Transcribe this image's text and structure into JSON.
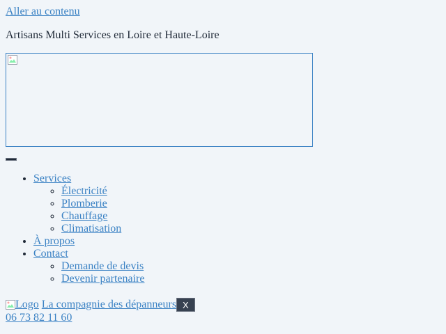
{
  "skip_link": "Aller au contenu",
  "tagline": "Artisans Multi Services en Loire et Haute-Loire",
  "banner": {
    "alt": ""
  },
  "menu_toggle": {
    "label": ""
  },
  "nav": {
    "items": [
      {
        "label": "Services",
        "children": [
          "Électricité",
          "Plomberie",
          "Chauffage",
          "Climatisation"
        ]
      },
      {
        "label": "À propos",
        "children": []
      },
      {
        "label": "Contact",
        "children": [
          "Demande de devis",
          "Devenir partenaire"
        ]
      }
    ]
  },
  "bottom_bar": {
    "logo_alt": "Logo",
    "brand_name": "La compagnie des dépanneurs",
    "close_label": "X",
    "phone": "06 73 82 11 60"
  },
  "colors": {
    "background": "#f1f5f9",
    "link": "#3b82c4",
    "text": "#1f2937",
    "close_button": "#374151"
  },
  "icons": {
    "banner": "broken-image-icon",
    "logo": "broken-image-icon"
  }
}
